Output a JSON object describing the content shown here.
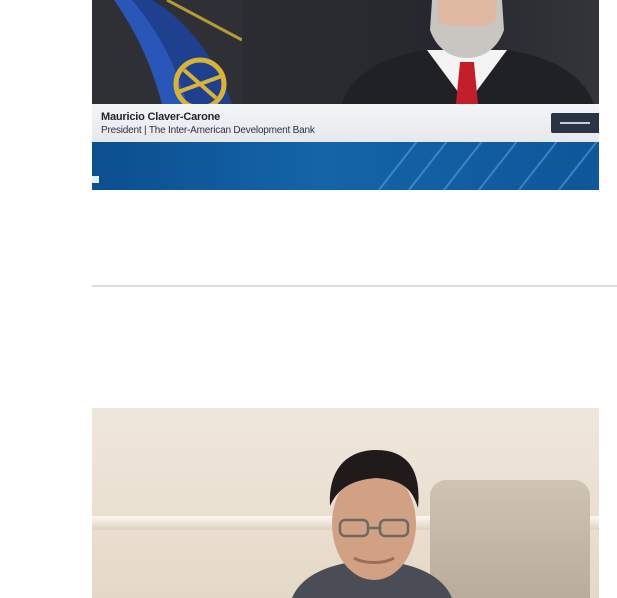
{
  "articles": [
    {
      "image": {
        "kind": "video-still",
        "lower_third": {
          "name": "Mauricio Claver-Carone",
          "title": "President | The Inter-American Development Bank"
        },
        "colors": {
          "band": "#1464a8",
          "lower_third_bg": "#eef0f3",
          "badge": "#2a3444"
        }
      }
    },
    {
      "image": {
        "kind": "photo",
        "colors": {
          "wall": "#efe7dc",
          "chair": "#c4b8a6"
        }
      }
    }
  ],
  "divider": {
    "color": "#dcdcdc"
  }
}
